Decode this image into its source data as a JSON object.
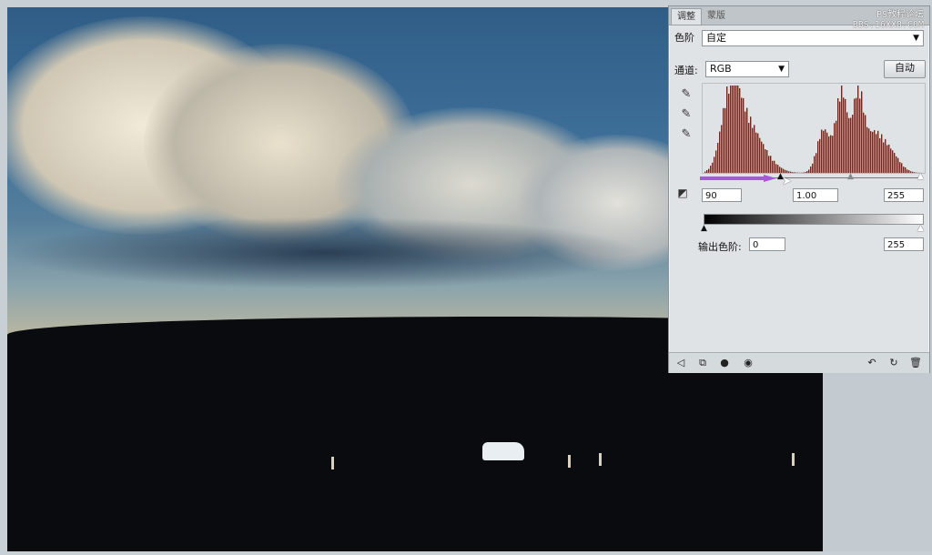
{
  "panel": {
    "tabs": [
      "调整",
      "蒙版"
    ],
    "preset_label": "色阶",
    "preset_value": "自定",
    "channel_label": "通道:",
    "channel_value": "RGB",
    "auto_button": "自动",
    "input_black": "90",
    "input_gamma": "1.00",
    "input_white": "255",
    "output_label": "输出色阶:",
    "output_black": "0",
    "output_white": "255"
  },
  "watermark": {
    "line1": "PS教程论坛",
    "line2": "BBS.16XX8.COM"
  },
  "icons": {
    "eyedropper_black": "eyedropper-black-icon",
    "eyedropper_gray": "eyedropper-gray-icon",
    "eyedropper_white": "eyedropper-white-icon",
    "on_image": "on-image-tool-icon"
  },
  "colors": {
    "histogram": "#6a2a22",
    "arrow": "#a45ad8"
  }
}
